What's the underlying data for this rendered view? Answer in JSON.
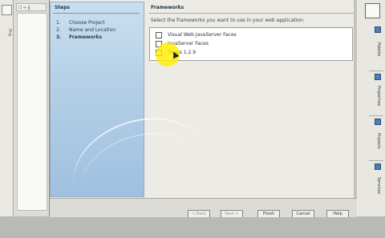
{
  "ide": {
    "left_strip_text": "Proj",
    "projects_tab": "☐ ← ‖",
    "side_tabs": [
      "Palette",
      "Properties",
      "Projects",
      "Services"
    ]
  },
  "dialog": {
    "steps": {
      "title": "Steps",
      "items": [
        {
          "num": "1.",
          "label": "Choose Project"
        },
        {
          "num": "2.",
          "label": "Name and Location"
        },
        {
          "num": "3.",
          "label": "Frameworks"
        }
      ]
    },
    "frameworks": {
      "title": "Frameworks",
      "instruction": "Select the frameworks you want to use in your web application:",
      "items": [
        {
          "label": "Visual Web JavaServer Faces",
          "checked": false
        },
        {
          "label": "JavaServer Faces",
          "checked": false
        },
        {
          "label": "Struts 1.2.9",
          "checked": false
        }
      ]
    },
    "buttons": {
      "back": "< Back",
      "next": "Next >",
      "finish": "Finish",
      "cancel": "Cancel",
      "help": "Help"
    }
  }
}
